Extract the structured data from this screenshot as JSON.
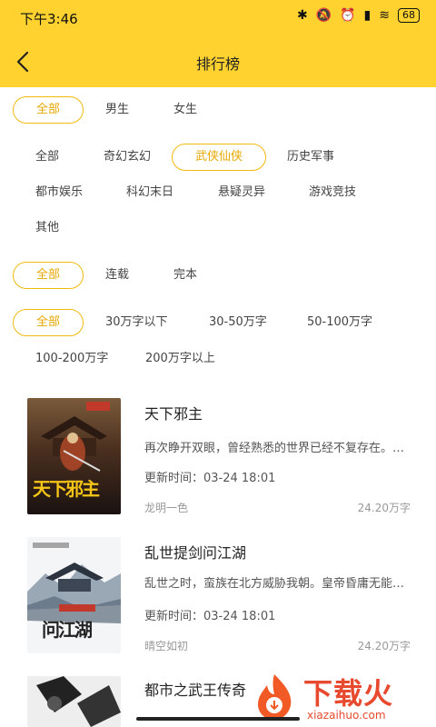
{
  "status": {
    "time": "下午3:46",
    "battery": "68"
  },
  "nav": {
    "title": "排行榜"
  },
  "filters": {
    "gender": [
      "全部",
      "男生",
      "女生"
    ],
    "category": [
      "全部",
      "奇幻玄幻",
      "武侠仙侠",
      "历史军事",
      "都市娱乐",
      "科幻末日",
      "悬疑灵异",
      "游戏竞技",
      "其他"
    ],
    "status": [
      "全部",
      "连载",
      "完本"
    ],
    "wordcount": [
      "全部",
      "30万字以下",
      "30-50万字",
      "50-100万字",
      "100-200万字",
      "200万字以上"
    ],
    "selected": {
      "gender": "全部",
      "category": "武侠仙侠",
      "status": "全部",
      "wordcount": "全部"
    }
  },
  "books": [
    {
      "title": "天下邪主",
      "desc": "再次睁开双眼，曾经熟悉的世界已经不复存在。…",
      "updated": "更新时间：03-24 18:01",
      "author": "龙明一色",
      "words": "24.20万字",
      "cover_text": "天下邪主"
    },
    {
      "title": "乱世提剑问江湖",
      "desc": "乱世之时，蛮族在北方威胁我朝。皇帝昏庸无能…",
      "updated": "更新时间：03-24 18:01",
      "author": "晴空如初",
      "words": "24.20万字",
      "cover_text": "问江湖"
    },
    {
      "title": "都市之武王传奇",
      "desc": "",
      "updated": "",
      "author": "",
      "words": ""
    }
  ],
  "watermark": {
    "text": "下载火",
    "url": "xiazaihuo.com"
  },
  "colors": {
    "accent": "#ffd230",
    "selected": "#e6a700",
    "brand": "#e84a2f"
  }
}
